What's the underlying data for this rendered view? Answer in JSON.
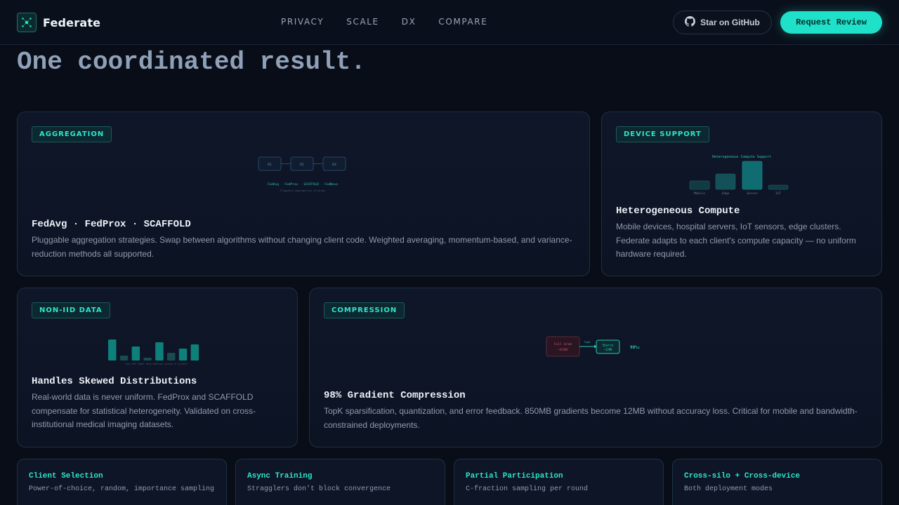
{
  "brand": {
    "name": "Federate"
  },
  "nav": {
    "links": [
      "PRIVACY",
      "SCALE",
      "DX",
      "COMPARE"
    ],
    "github_label": "Star on GitHub",
    "cta_label": "Request Review"
  },
  "hero": {
    "headline": "One coordinated result."
  },
  "cards": {
    "aggregation": {
      "tag": "AGGREGATION",
      "title": "FedAvg · FedProx · SCAFFOLD",
      "description": "Pluggable aggregation strategies. Swap between algorithms without changing client code. Weighted averaging, momentum-based, and variance-reduction methods all supported.",
      "illustration": {
        "nodes": [
          "R1",
          "R2",
          "R3"
        ],
        "strategies": "FedAvg · FedProx · SCAFFOLD · FedNova",
        "caption": "Pluggable aggregation strategy"
      }
    },
    "device": {
      "tag": "DEVICE SUPPORT",
      "title": "Heterogeneous Compute",
      "description": "Mobile devices, hospital servers, IoT sensors, edge clusters. Federate adapts to each client's compute capacity — no uniform hardware required.",
      "illustration": {
        "title": "Heterogeneous Compute Support",
        "devices": [
          "Mobile",
          "Edge",
          "Server",
          "IoT"
        ]
      }
    },
    "noniid": {
      "tag": "NON-IID DATA",
      "title": "Handles Skewed Distributions",
      "description": "Real-world data is never uniform. FedProx and SCAFFOLD compensate for statistical heterogeneity. Validated on cross-institutional medical imaging datasets.",
      "illustration": {
        "caption": "non-IID label distribution across 8 clients"
      }
    },
    "compression": {
      "tag": "COMPRESSION",
      "title": "98% Gradient Compression",
      "description": "TopK sparsification, quantization, and error feedback. 850MB gradients become 12MB without accuracy loss. Critical for mobile and bandwidth-constrained deployments.",
      "illustration": {
        "full_label": "Full Grad",
        "full_size": "~850MB",
        "arrow_label": "TopK",
        "sparse_label": "Sparse",
        "sparse_size": "~12MB",
        "ratio": "98%↓"
      }
    }
  },
  "features": [
    {
      "title": "Client Selection",
      "description": "Power-of-choice, random, importance sampling"
    },
    {
      "title": "Async Training",
      "description": "Stragglers don't block convergence"
    },
    {
      "title": "Partial Participation",
      "description": "C-fraction sampling per round"
    },
    {
      "title": "Cross-silo + Cross-device",
      "description": "Both deployment modes"
    }
  ],
  "colors": {
    "accent": "#1fe0c8",
    "background": "#080d17",
    "card": "#0e1628",
    "danger": "#e05a6a"
  }
}
